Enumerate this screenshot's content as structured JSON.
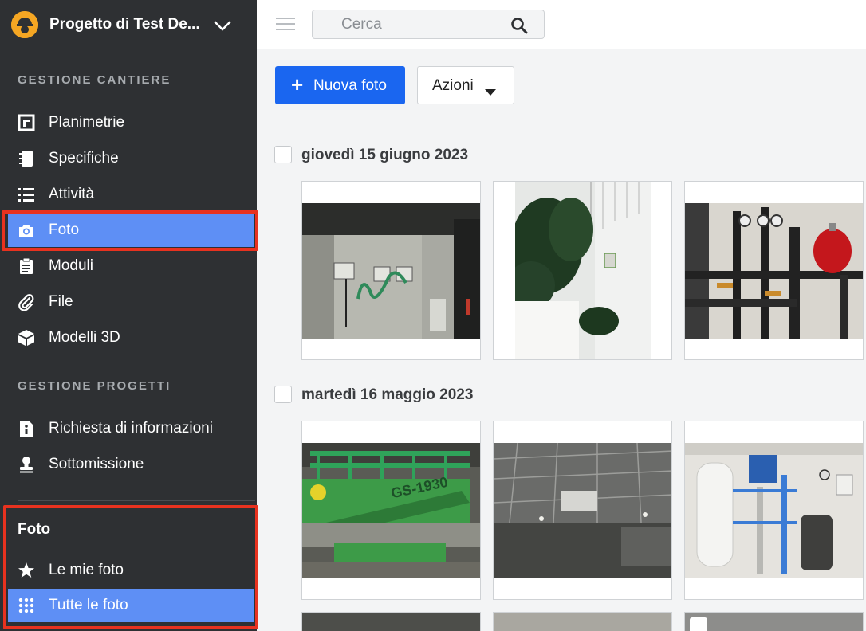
{
  "project": {
    "name": "Progetto di Test De..."
  },
  "sidebar": {
    "section1_title": "GESTIONE CANTIERE",
    "items1": [
      {
        "label": "Planimetrie",
        "icon": "floorplan-icon"
      },
      {
        "label": "Specifiche",
        "icon": "notebook-icon"
      },
      {
        "label": "Attività",
        "icon": "list-icon"
      },
      {
        "label": "Foto",
        "icon": "camera-icon",
        "active": true
      },
      {
        "label": "Moduli",
        "icon": "clipboard-icon"
      },
      {
        "label": "File",
        "icon": "paperclip-icon"
      },
      {
        "label": "Modelli 3D",
        "icon": "cube-icon"
      }
    ],
    "section2_title": "GESTIONE PROGETTI",
    "items2": [
      {
        "label": "Richiesta di informazioni",
        "icon": "info-document-icon"
      },
      {
        "label": "Sottomissione",
        "icon": "stamp-icon"
      }
    ],
    "sub_title": "Foto",
    "sub_items": [
      {
        "label": "Le mie foto",
        "icon": "star-icon"
      },
      {
        "label": "Tutte le foto",
        "icon": "grid-icon",
        "active": true
      }
    ]
  },
  "search": {
    "placeholder": "Cerca",
    "value": ""
  },
  "toolbar": {
    "new_photo_label": "Nuova foto",
    "actions_label": "Azioni"
  },
  "groups": [
    {
      "date": "giovedì 15 giugno 2023",
      "photos": [
        "wall-sockets",
        "plant",
        "boiler-room-red-tank"
      ]
    },
    {
      "date": "martedì 16 maggio 2023",
      "photos": [
        "green-scissor-lift",
        "ceiling-grid",
        "water-treatment-plant"
      ]
    }
  ],
  "lift_text": "GS-1930",
  "colors": {
    "accent": "#1a66f0",
    "active_nav": "#5e8ff5",
    "sidebar_bg": "#2e3033",
    "highlight_box": "#e8321f"
  }
}
